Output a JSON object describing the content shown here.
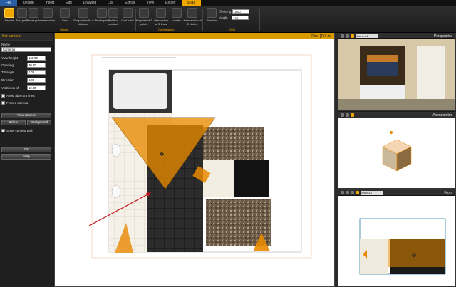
{
  "menubar": {
    "items": [
      {
        "label": "File",
        "state": "file"
      },
      {
        "label": "Design",
        "state": ""
      },
      {
        "label": "Insert",
        "state": ""
      },
      {
        "label": "Edit",
        "state": ""
      },
      {
        "label": "Drawing",
        "state": ""
      },
      {
        "label": "Lay",
        "state": ""
      },
      {
        "label": "Extras",
        "state": ""
      },
      {
        "label": "View",
        "state": ""
      },
      {
        "label": "Expert",
        "state": ""
      },
      {
        "label": "Snap",
        "state": "active"
      }
    ]
  },
  "ribbon": {
    "simple_tools": [
      "Handle",
      "End point",
      "Center point",
      "Intersection",
      "Line",
      "Endpoint with a distance",
      "Plumb point",
      "Point of contact",
      "Grid point"
    ],
    "simple_label": "Simple",
    "combination_tools": [
      "Midpoint of 2 points",
      "Intersection of 2 lines",
      "center",
      "Intersection of 2 circles"
    ],
    "combination_label": "Combination",
    "grid_tool": "Position",
    "grid_label": "Grid",
    "spacing_label": "Spacing",
    "spacing_value": "10.00",
    "angle_label": "Angle",
    "angle_value": "0.00"
  },
  "camera_panel": {
    "title": "Set camera",
    "name_label": "Name",
    "name_value": "Camera1",
    "view_height_label": "View height",
    "view_height_value": "160.00",
    "opening_label": "Opening",
    "opening_value": "70.00",
    "tilt_label": "Tilt angle",
    "tilt_value": "0.00",
    "direction_label": "Direction",
    "direction_value": "1.00",
    "visible_label": "Visible as of",
    "visible_value": "10.00",
    "avoid_label": "Avoid aberrant lines",
    "freeze_label": "Freeze camera",
    "new_camera": "New camera",
    "delete": "Delete",
    "background": "Background",
    "show_path_label": "Show camera path",
    "ok": "OK",
    "help": "Help"
  },
  "plan_view": {
    "title": "Plan  [7x7 m]"
  },
  "perspective_view": {
    "title": "Perspective",
    "camera_select": "Camera1"
  },
  "axonometric_view": {
    "title": "Axonometric"
  },
  "front_view": {
    "title": "Front",
    "select": "Wand10"
  },
  "colors": {
    "accent": "#f0a800",
    "camera_fill": "#e88a00"
  }
}
